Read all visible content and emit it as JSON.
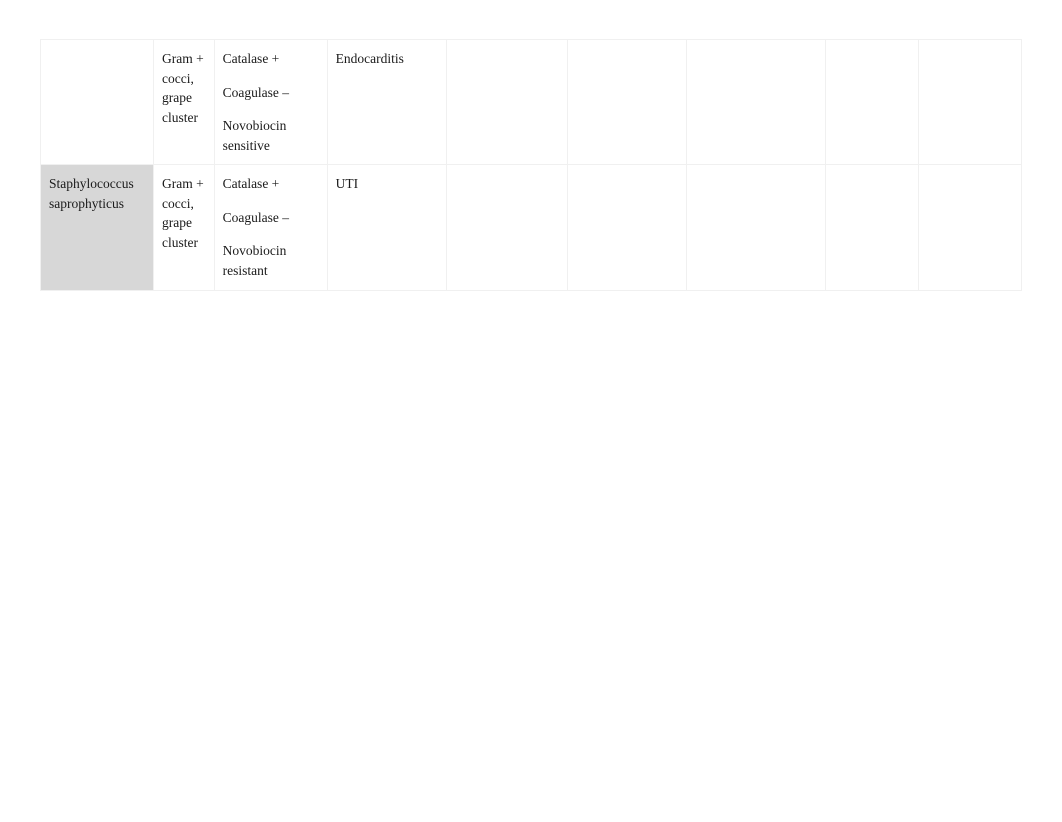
{
  "document": {
    "type": "microbiology-reference-table",
    "background_color": "#ffffff",
    "gridline_color": "#f0f0f0",
    "shaded_cell_color": "#d7d7d7",
    "text_color": "#1a1a1a"
  },
  "table": {
    "column_count": 9,
    "row_count": 2,
    "rows": [
      {
        "organism": "",
        "organism_shaded": false,
        "gram": [
          "Gram +",
          "cocci,",
          "grape",
          "cluster"
        ],
        "lab": [
          "Catalase +",
          "Coagulase –",
          "Novobiocin sensitive"
        ],
        "disease": "Endocarditis",
        "extra": [
          "",
          "",
          "",
          "",
          ""
        ]
      },
      {
        "organism": "Staphylococcus saprophyticus",
        "organism_shaded": true,
        "gram": [
          "Gram +",
          "cocci,",
          "grape",
          "cluster"
        ],
        "lab": [
          "Catalase +",
          "Coagulase –",
          "Novobiocin resistant"
        ],
        "disease": "UTI",
        "extra": [
          "",
          "",
          "",
          "",
          ""
        ]
      }
    ]
  }
}
